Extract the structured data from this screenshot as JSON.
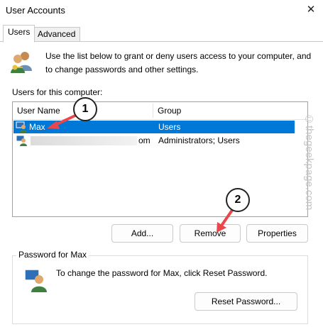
{
  "window": {
    "title": "User Accounts",
    "close_glyph": "✕"
  },
  "tabs": [
    {
      "label": "Users",
      "active": true
    },
    {
      "label": "Advanced",
      "active": false
    }
  ],
  "intro_text": "Use the list below to grant or deny users access to your computer, and to change passwords and other settings.",
  "users_label": "Users for this computer:",
  "table": {
    "columns": [
      "User Name",
      "Group"
    ],
    "rows": [
      {
        "name": "Max",
        "group": "Users",
        "selected": true
      },
      {
        "name": "om",
        "group": "Administrators; Users",
        "selected": false,
        "name_partially_hidden": true
      }
    ]
  },
  "buttons": {
    "add": "Add...",
    "remove": "Remove",
    "properties": "Properties",
    "reset_password": "Reset Password..."
  },
  "password_group": {
    "title": "Password for Max",
    "text": "To change the password for Max, click Reset Password."
  },
  "annotations": {
    "marker1": "1",
    "marker2": "2",
    "color": "#e8474c"
  },
  "watermark": "©thegeekpage.com",
  "colors": {
    "selection": "#0078d7"
  }
}
